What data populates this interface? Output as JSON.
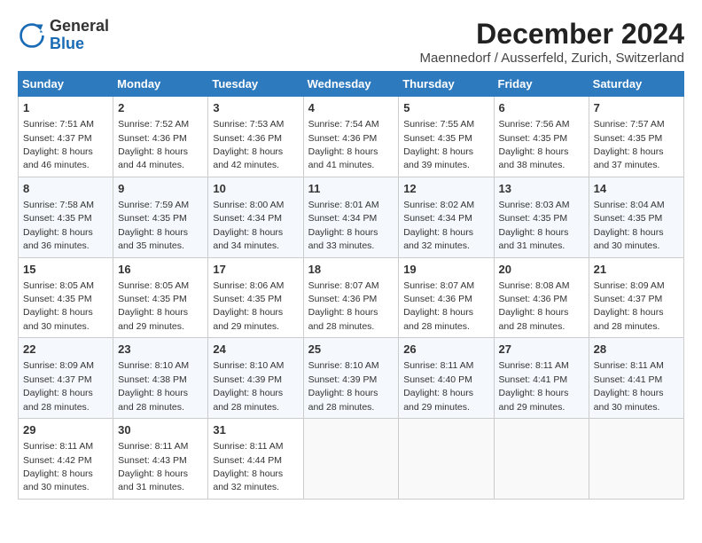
{
  "logo": {
    "general": "General",
    "blue": "Blue"
  },
  "title": "December 2024",
  "location": "Maennedorf / Ausserfeld, Zurich, Switzerland",
  "days_of_week": [
    "Sunday",
    "Monday",
    "Tuesday",
    "Wednesday",
    "Thursday",
    "Friday",
    "Saturday"
  ],
  "weeks": [
    [
      {
        "day": "1",
        "sunrise": "7:51 AM",
        "sunset": "4:37 PM",
        "daylight": "8 hours and 46 minutes."
      },
      {
        "day": "2",
        "sunrise": "7:52 AM",
        "sunset": "4:36 PM",
        "daylight": "8 hours and 44 minutes."
      },
      {
        "day": "3",
        "sunrise": "7:53 AM",
        "sunset": "4:36 PM",
        "daylight": "8 hours and 42 minutes."
      },
      {
        "day": "4",
        "sunrise": "7:54 AM",
        "sunset": "4:36 PM",
        "daylight": "8 hours and 41 minutes."
      },
      {
        "day": "5",
        "sunrise": "7:55 AM",
        "sunset": "4:35 PM",
        "daylight": "8 hours and 39 minutes."
      },
      {
        "day": "6",
        "sunrise": "7:56 AM",
        "sunset": "4:35 PM",
        "daylight": "8 hours and 38 minutes."
      },
      {
        "day": "7",
        "sunrise": "7:57 AM",
        "sunset": "4:35 PM",
        "daylight": "8 hours and 37 minutes."
      }
    ],
    [
      {
        "day": "8",
        "sunrise": "7:58 AM",
        "sunset": "4:35 PM",
        "daylight": "8 hours and 36 minutes."
      },
      {
        "day": "9",
        "sunrise": "7:59 AM",
        "sunset": "4:35 PM",
        "daylight": "8 hours and 35 minutes."
      },
      {
        "day": "10",
        "sunrise": "8:00 AM",
        "sunset": "4:34 PM",
        "daylight": "8 hours and 34 minutes."
      },
      {
        "day": "11",
        "sunrise": "8:01 AM",
        "sunset": "4:34 PM",
        "daylight": "8 hours and 33 minutes."
      },
      {
        "day": "12",
        "sunrise": "8:02 AM",
        "sunset": "4:34 PM",
        "daylight": "8 hours and 32 minutes."
      },
      {
        "day": "13",
        "sunrise": "8:03 AM",
        "sunset": "4:35 PM",
        "daylight": "8 hours and 31 minutes."
      },
      {
        "day": "14",
        "sunrise": "8:04 AM",
        "sunset": "4:35 PM",
        "daylight": "8 hours and 30 minutes."
      }
    ],
    [
      {
        "day": "15",
        "sunrise": "8:05 AM",
        "sunset": "4:35 PM",
        "daylight": "8 hours and 30 minutes."
      },
      {
        "day": "16",
        "sunrise": "8:05 AM",
        "sunset": "4:35 PM",
        "daylight": "8 hours and 29 minutes."
      },
      {
        "day": "17",
        "sunrise": "8:06 AM",
        "sunset": "4:35 PM",
        "daylight": "8 hours and 29 minutes."
      },
      {
        "day": "18",
        "sunrise": "8:07 AM",
        "sunset": "4:36 PM",
        "daylight": "8 hours and 28 minutes."
      },
      {
        "day": "19",
        "sunrise": "8:07 AM",
        "sunset": "4:36 PM",
        "daylight": "8 hours and 28 minutes."
      },
      {
        "day": "20",
        "sunrise": "8:08 AM",
        "sunset": "4:36 PM",
        "daylight": "8 hours and 28 minutes."
      },
      {
        "day": "21",
        "sunrise": "8:09 AM",
        "sunset": "4:37 PM",
        "daylight": "8 hours and 28 minutes."
      }
    ],
    [
      {
        "day": "22",
        "sunrise": "8:09 AM",
        "sunset": "4:37 PM",
        "daylight": "8 hours and 28 minutes."
      },
      {
        "day": "23",
        "sunrise": "8:10 AM",
        "sunset": "4:38 PM",
        "daylight": "8 hours and 28 minutes."
      },
      {
        "day": "24",
        "sunrise": "8:10 AM",
        "sunset": "4:39 PM",
        "daylight": "8 hours and 28 minutes."
      },
      {
        "day": "25",
        "sunrise": "8:10 AM",
        "sunset": "4:39 PM",
        "daylight": "8 hours and 28 minutes."
      },
      {
        "day": "26",
        "sunrise": "8:11 AM",
        "sunset": "4:40 PM",
        "daylight": "8 hours and 29 minutes."
      },
      {
        "day": "27",
        "sunrise": "8:11 AM",
        "sunset": "4:41 PM",
        "daylight": "8 hours and 29 minutes."
      },
      {
        "day": "28",
        "sunrise": "8:11 AM",
        "sunset": "4:41 PM",
        "daylight": "8 hours and 30 minutes."
      }
    ],
    [
      {
        "day": "29",
        "sunrise": "8:11 AM",
        "sunset": "4:42 PM",
        "daylight": "8 hours and 30 minutes."
      },
      {
        "day": "30",
        "sunrise": "8:11 AM",
        "sunset": "4:43 PM",
        "daylight": "8 hours and 31 minutes."
      },
      {
        "day": "31",
        "sunrise": "8:11 AM",
        "sunset": "4:44 PM",
        "daylight": "8 hours and 32 minutes."
      },
      null,
      null,
      null,
      null
    ]
  ]
}
